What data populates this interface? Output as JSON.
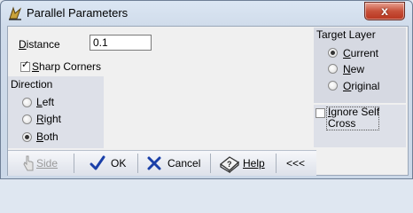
{
  "window": {
    "title": "Parallel Parameters",
    "close_label": "x"
  },
  "distance": {
    "label_first": "D",
    "label_rest": "istance",
    "value": "0.1"
  },
  "sharp_corners": {
    "label_first": "S",
    "label_rest": "harp Corners",
    "checked": true
  },
  "direction": {
    "title": "Direction",
    "options": [
      {
        "first": "L",
        "rest": "eft",
        "selected": false
      },
      {
        "first": "R",
        "rest": "ight",
        "selected": false
      },
      {
        "first": "B",
        "rest": "oth",
        "selected": true
      }
    ]
  },
  "target_layer": {
    "title": "Target Layer",
    "options": [
      {
        "first": "C",
        "rest": "urrent",
        "selected": true
      },
      {
        "first": "N",
        "rest": "ew",
        "selected": false
      },
      {
        "first": "O",
        "rest": "riginal",
        "selected": false
      }
    ]
  },
  "ignore_self_cross": {
    "line1_first": "I",
    "line1_rest": "gnore Self",
    "line2": "Cross",
    "checked": false
  },
  "toolbar": {
    "side_label": "Side",
    "ok_label": "OK",
    "cancel_label": "Cancel",
    "help_label": "Help",
    "collapse_label": "<<<"
  },
  "colors": {
    "accent_blue": "#1a3fa8",
    "close_red": "#c7513a",
    "disabled_text": "#9a9a9a"
  }
}
